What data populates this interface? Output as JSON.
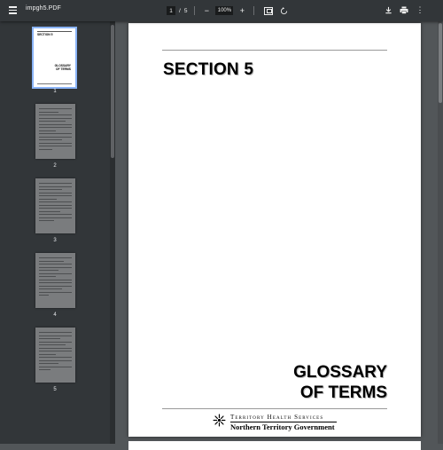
{
  "toolbar": {
    "title": "impgh5.PDF",
    "current_page": "1",
    "separator": "/",
    "total_pages": "5",
    "zoom_out": "−",
    "zoom_level": "100%",
    "zoom_in": "+",
    "more": "⋮"
  },
  "sidebar": {
    "thumbnails": [
      {
        "label": "1",
        "selected": true
      },
      {
        "label": "2",
        "selected": false
      },
      {
        "label": "3",
        "selected": false
      },
      {
        "label": "4",
        "selected": false
      },
      {
        "label": "5",
        "selected": false
      }
    ]
  },
  "document": {
    "section_title": "SECTION 5",
    "glossary_line1": "GLOSSARY",
    "glossary_line2": "OF TERMS",
    "org_line1": "Territory Health Services",
    "org_line2": "Northern Territory Government"
  },
  "colors": {
    "toolbar_bg": "#323639",
    "viewer_bg": "#525659",
    "selection": "#8ab4f8"
  }
}
